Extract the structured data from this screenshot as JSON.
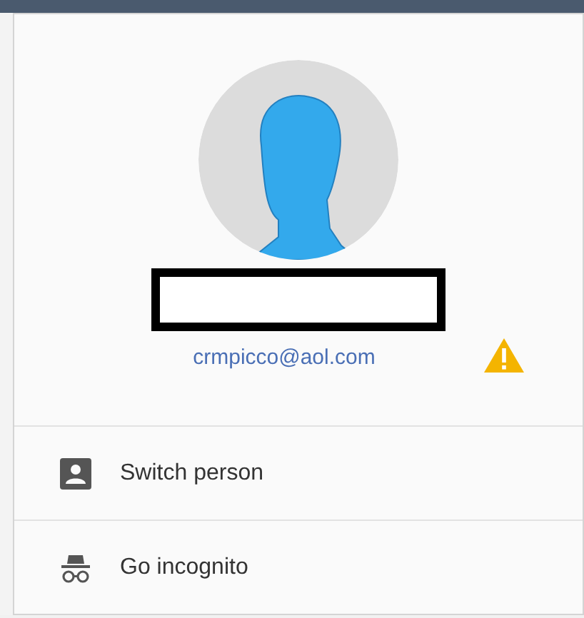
{
  "account": {
    "email": "crmpicco@aol.com",
    "sync_warning": true
  },
  "menu_items": [
    {
      "kind": "switch-person",
      "label": "Switch person"
    },
    {
      "kind": "incognito",
      "label": "Go incognito"
    }
  ]
}
